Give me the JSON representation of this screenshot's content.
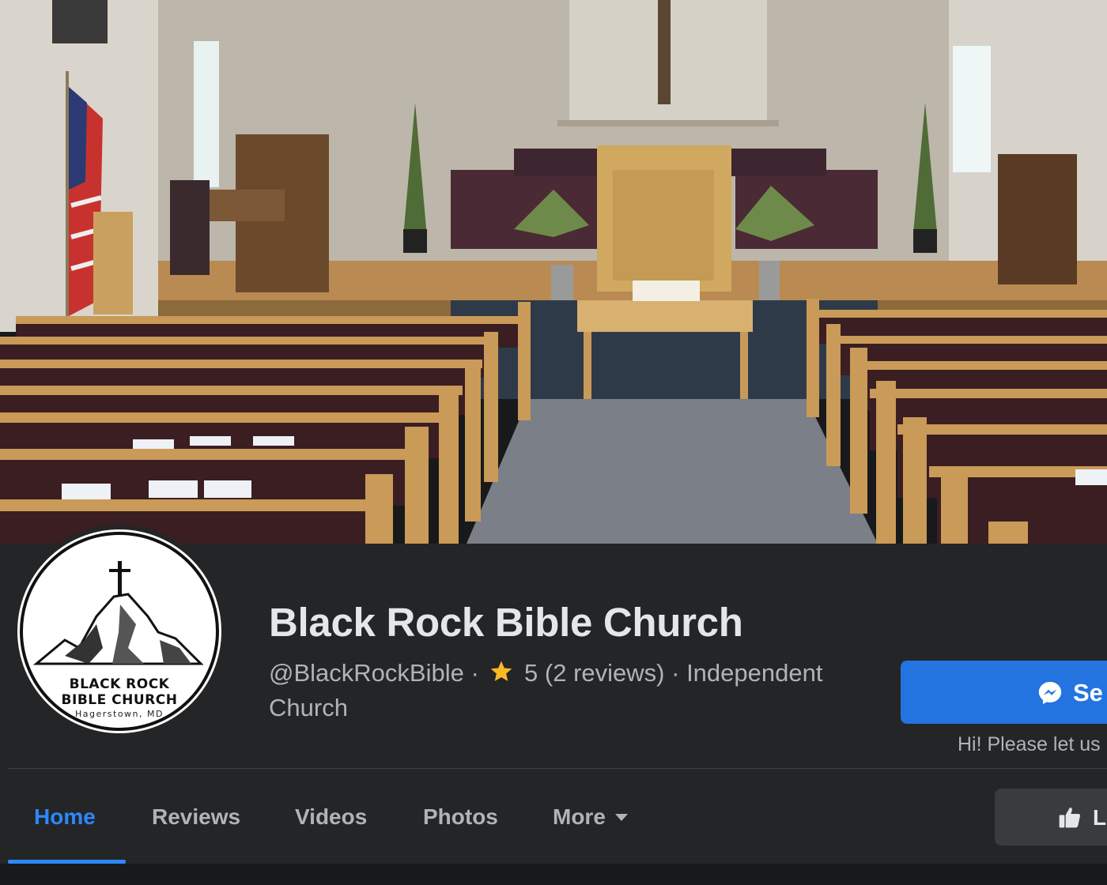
{
  "page": {
    "name": "Black Rock Bible Church",
    "handle": "@BlackRockBible",
    "rating": "5",
    "reviews": "(2 reviews)",
    "category": "Independent Church"
  },
  "logo": {
    "line1": "BLACK ROCK",
    "line2": "BIBLE CHURCH",
    "line3": "Hagerstown, MD"
  },
  "actions": {
    "send_label": "Se",
    "send_note": "Hi! Please let us",
    "like_label": "L"
  },
  "tabs": [
    {
      "label": "Home",
      "active": true
    },
    {
      "label": "Reviews",
      "active": false
    },
    {
      "label": "Videos",
      "active": false
    },
    {
      "label": "Photos",
      "active": false
    },
    {
      "label": "More",
      "active": false
    }
  ],
  "icons": {
    "star": "star-icon",
    "messenger": "messenger-icon",
    "like": "thumbs-up-icon",
    "more": "caret-down-icon"
  },
  "colors": {
    "accent": "#2d88ff",
    "button": "#2374e1",
    "star": "#f7b928",
    "background": "#242526"
  }
}
